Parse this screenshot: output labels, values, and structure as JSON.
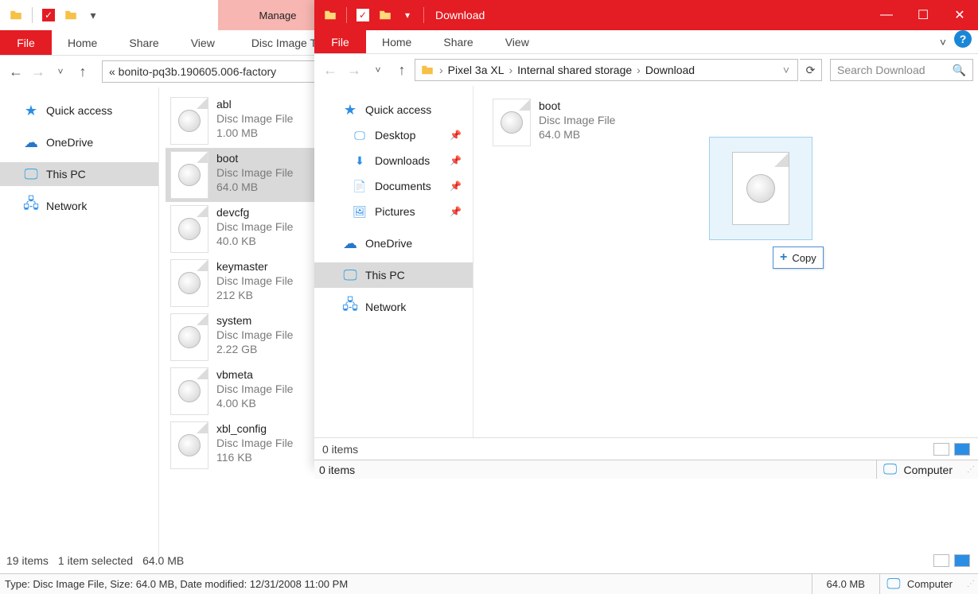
{
  "win_a": {
    "manage_label": "Manage",
    "ribbon": {
      "file": "File",
      "home": "Home",
      "share": "Share",
      "view": "View",
      "context": "Disc Image Tools"
    },
    "address": "«   bonito-pq3b.190605.006-factory",
    "nav": {
      "quick_access": "Quick access",
      "onedrive": "OneDrive",
      "this_pc": "This PC",
      "network": "Network"
    },
    "files": [
      {
        "name": "abl",
        "type": "Disc Image File",
        "size": "1.00 MB"
      },
      {
        "name": "boot",
        "type": "Disc Image File",
        "size": "64.0 MB"
      },
      {
        "name": "devcfg",
        "type": "Disc Image File",
        "size": "40.0 KB"
      },
      {
        "name": "keymaster",
        "type": "Disc Image File",
        "size": "212 KB"
      },
      {
        "name": "system",
        "type": "Disc Image File",
        "size": "2.22 GB"
      },
      {
        "name": "vbmeta",
        "type": "Disc Image File",
        "size": "4.00 KB"
      },
      {
        "name": "xbl_config",
        "type": "Disc Image File",
        "size": "116 KB"
      }
    ],
    "status": {
      "count": "19 items",
      "selection": "1 item selected",
      "sel_size": "64.0 MB"
    },
    "tooltip": "Type: Disc Image File, Size: 64.0 MB, Date modified: 12/31/2008 11:00 PM",
    "status2_size": "64.0 MB",
    "status2_comp": "Computer"
  },
  "win_b": {
    "title": "Download",
    "ribbon": {
      "file": "File",
      "home": "Home",
      "share": "Share",
      "view": "View"
    },
    "breadcrumbs": [
      "Pixel 3a XL",
      "Internal shared storage",
      "Download"
    ],
    "search_placeholder": "Search Download",
    "nav": {
      "quick_access": "Quick access",
      "desktop": "Desktop",
      "downloads": "Downloads",
      "documents": "Documents",
      "pictures": "Pictures",
      "onedrive": "OneDrive",
      "this_pc": "This PC",
      "network": "Network"
    },
    "file": {
      "name": "boot",
      "type": "Disc Image File",
      "size": "64.0 MB"
    },
    "copy_hint": "Copy",
    "status": {
      "count": "0 items"
    },
    "status2": {
      "count": "0 items",
      "comp": "Computer"
    }
  }
}
